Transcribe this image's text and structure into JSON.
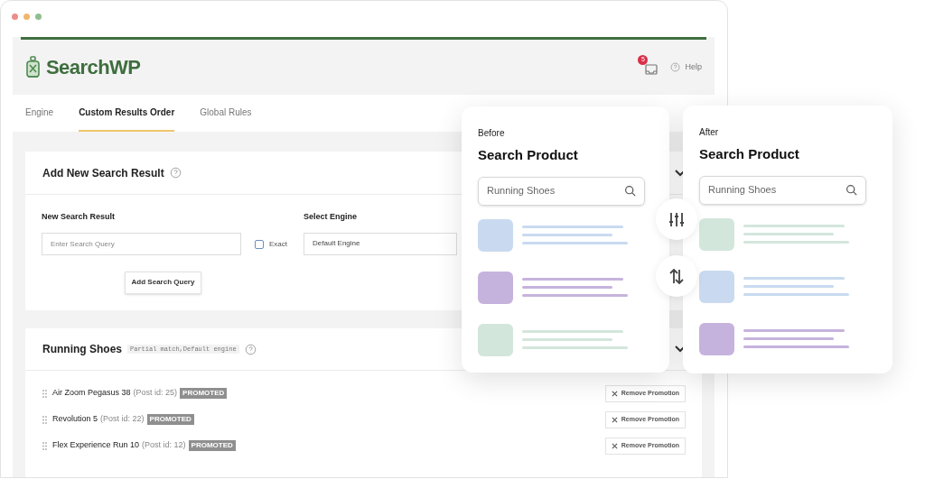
{
  "header": {
    "logo_text": "SearchWP",
    "notification_count": "5",
    "help": "Help"
  },
  "tabs": [
    {
      "label": "Engine",
      "selected": false
    },
    {
      "label": "Custom Results Order",
      "selected": true
    },
    {
      "label": "Global Rules",
      "selected": false
    }
  ],
  "add_panel": {
    "title": "Add New Search Result",
    "query_label": "New Search Result",
    "query_placeholder": "Enter Search Query",
    "exact": {
      "label": "Exact",
      "checked": false
    },
    "engine_label": "Select Engine",
    "engine_value": "Default Engine",
    "button": "Add Search Query"
  },
  "result_panel": {
    "title": "Running Shoes",
    "tag": "Partial match,Default engine",
    "items": [
      {
        "name": "Air Zoom Pegasus 38",
        "post_id": "(Post id: 25)",
        "badge": "PROMOTED",
        "action": "Remove Promotion"
      },
      {
        "name": "Revolution 5",
        "post_id": "(Post id: 22)",
        "badge": "PROMOTED",
        "action": "Remove Promotion"
      },
      {
        "name": "Flex Experience Run 10",
        "post_id": "(Post id: 12)",
        "badge": "PROMOTED",
        "action": "Remove Promotion"
      }
    ]
  },
  "comparison": [
    {
      "label": "Before",
      "title": "Search Product",
      "query": "Running Shoes",
      "results": [
        {
          "color": "#c9daf0"
        },
        {
          "color": "#c6b3dd"
        },
        {
          "color": "#d3e6dc"
        }
      ]
    },
    {
      "label": "After",
      "title": "Search Product",
      "query": "Running Shoes",
      "results": [
        {
          "color": "#d3e6dc"
        },
        {
          "color": "#c9daf0"
        },
        {
          "color": "#c6b3dd"
        }
      ]
    }
  ]
}
